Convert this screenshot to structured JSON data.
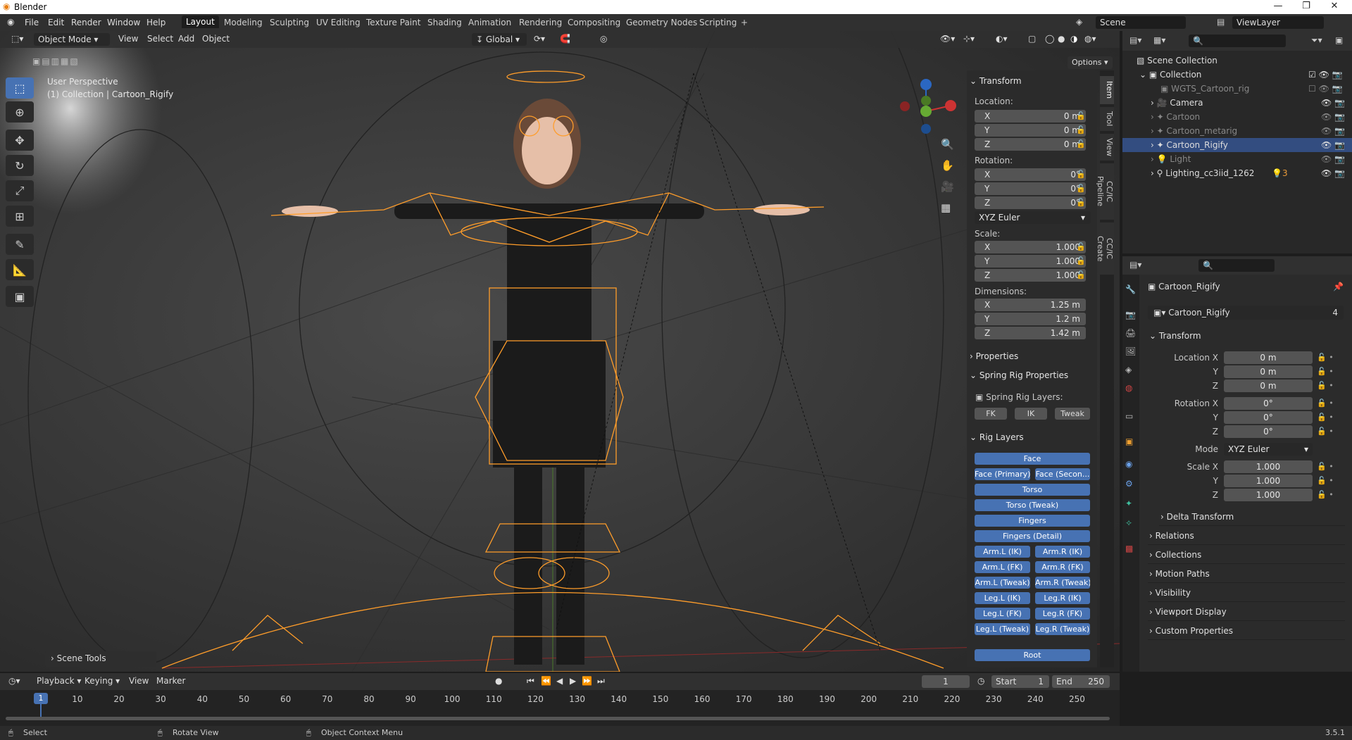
{
  "window": {
    "title": "Blender"
  },
  "menus": [
    "File",
    "Edit",
    "Render",
    "Window",
    "Help"
  ],
  "workspaces": [
    "Layout",
    "Modeling",
    "Sculpting",
    "UV Editing",
    "Texture Paint",
    "Shading",
    "Animation",
    "Rendering",
    "Compositing",
    "Geometry Nodes",
    "Scripting"
  ],
  "scene": {
    "name": "Scene",
    "view_layer": "ViewLayer"
  },
  "viewport": {
    "mode": "Object Mode",
    "menu": [
      "View",
      "Select",
      "Add",
      "Object"
    ],
    "orientation": "Global",
    "options": "Options",
    "perspective": "User Perspective",
    "collection_label": "(1) Collection | Cartoon_Rigify",
    "scene_tools": "Scene Tools"
  },
  "npanel": {
    "tabs": [
      "Item",
      "Tool",
      "View",
      "CC/IC Pipeline",
      "CC/IC Create"
    ],
    "transform": "Transform",
    "location_label": "Location:",
    "location": {
      "x": "0 m",
      "y": "0 m",
      "z": "0 m"
    },
    "rotation_label": "Rotation:",
    "rotation": {
      "x": "0°",
      "y": "0°",
      "z": "0°"
    },
    "rotation_mode": "XYZ Euler",
    "scale_label": "Scale:",
    "scale": {
      "x": "1.000",
      "y": "1.000",
      "z": "1.000"
    },
    "dimensions_label": "Dimensions:",
    "dimensions": {
      "x": "1.25 m",
      "y": "1.2 m",
      "z": "1.42 m"
    },
    "axes": [
      "X",
      "Y",
      "Z"
    ],
    "properties": "Properties",
    "spring": {
      "title": "Spring Rig Properties",
      "layers_label": "Spring Rig Layers:",
      "buttons": [
        "FK",
        "IK",
        "Tweak"
      ]
    },
    "rig_layers": {
      "title": "Rig Layers",
      "face": "Face",
      "face_primary": "Face (Primary)",
      "face_secondary": "Face (Secon...",
      "torso": "Torso",
      "torso_tweak": "Torso (Tweak)",
      "fingers": "Fingers",
      "fingers_detail": "Fingers (Detail)",
      "arm_l_ik": "Arm.L (IK)",
      "arm_r_ik": "Arm.R (IK)",
      "arm_l_fk": "Arm.L (FK)",
      "arm_r_fk": "Arm.R (FK)",
      "arm_l_tw": "Arm.L (Tweak)",
      "arm_r_tw": "Arm.R (Tweak)",
      "leg_l_ik": "Leg.L (IK)",
      "leg_r_ik": "Leg.R (IK)",
      "leg_l_fk": "Leg.L (FK)",
      "leg_r_fk": "Leg.R (FK)",
      "leg_l_tw": "Leg.L (Tweak)",
      "leg_r_tw": "Leg.R (Tweak)",
      "root": "Root"
    }
  },
  "outliner": {
    "root": "Scene Collection",
    "collection": "Collection",
    "items": [
      "WGTS_Cartoon_rig",
      "Camera",
      "Cartoon",
      "Cartoon_metarig",
      "Cartoon_Rigify",
      "Light",
      "Lighting_cc3iid_1262"
    ],
    "light_count": "3"
  },
  "properties": {
    "object": "Cartoon_Rigify",
    "datablock": "Cartoon_Rigify",
    "users": "4",
    "transform": "Transform",
    "location_x_label": "Location X",
    "y_label": "Y",
    "z_label": "Z",
    "rotation_x_label": "Rotation X",
    "mode_label": "Mode",
    "scale_x_label": "Scale X",
    "location": [
      "0 m",
      "0 m",
      "0 m"
    ],
    "rotation": [
      "0°",
      "0°",
      "0°"
    ],
    "mode": "XYZ Euler",
    "scale": [
      "1.000",
      "1.000",
      "1.000"
    ],
    "sections": [
      "Delta Transform",
      "Relations",
      "Collections",
      "Motion Paths",
      "Visibility",
      "Viewport Display",
      "Custom Properties"
    ]
  },
  "timeline": {
    "menus": [
      "Playback",
      "Keying",
      "View",
      "Marker"
    ],
    "current": "1",
    "start_label": "Start",
    "start": "1",
    "end_label": "End",
    "end": "250",
    "ticks": [
      "1",
      "10",
      "20",
      "30",
      "40",
      "50",
      "60",
      "70",
      "80",
      "90",
      "100",
      "110",
      "120",
      "130",
      "140",
      "150",
      "160",
      "170",
      "180",
      "190",
      "200",
      "210",
      "220",
      "230",
      "240",
      "250"
    ]
  },
  "status": {
    "select": "Select",
    "rotate": "Rotate View",
    "context": "Object Context Menu",
    "version": "3.5.1"
  },
  "colors": {
    "accent": "#4772b3",
    "rig": "#ff9d2a",
    "selected_row": "#334d80"
  }
}
